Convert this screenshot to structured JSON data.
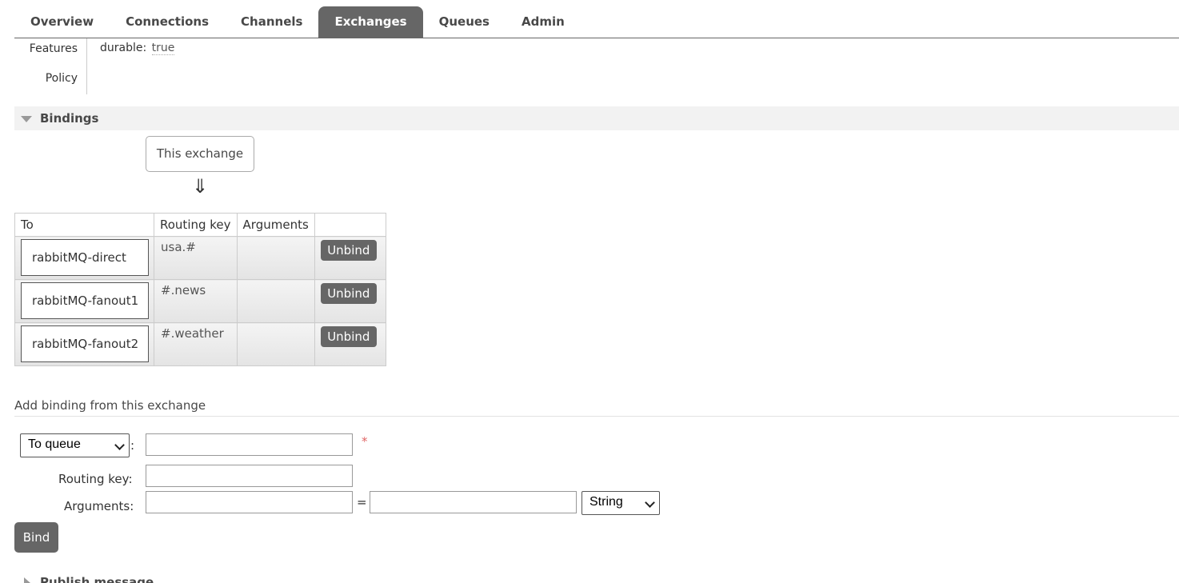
{
  "nav": {
    "tabs": [
      {
        "label": "Overview"
      },
      {
        "label": "Connections"
      },
      {
        "label": "Channels"
      },
      {
        "label": "Exchanges",
        "active": true
      },
      {
        "label": "Queues"
      },
      {
        "label": "Admin"
      }
    ]
  },
  "details": {
    "features_label": "Features",
    "policy_label": "Policy",
    "durable_key": "durable:",
    "durable_value": "true"
  },
  "bindings": {
    "title": "Bindings",
    "this_exchange": "This exchange",
    "arrow": "⇓",
    "columns": [
      "To",
      "Routing key",
      "Arguments",
      ""
    ],
    "rows": [
      {
        "to": "rabbitMQ-direct",
        "routing_key": "usa.#",
        "arguments": "",
        "action": "Unbind"
      },
      {
        "to": "rabbitMQ-fanout1",
        "routing_key": "#.news",
        "arguments": "",
        "action": "Unbind"
      },
      {
        "to": "rabbitMQ-fanout2",
        "routing_key": "#.weather",
        "arguments": "",
        "action": "Unbind"
      }
    ]
  },
  "add_binding": {
    "title": "Add binding from this exchange",
    "dest_type": "To queue",
    "dest_colon": ":",
    "dest_value": "",
    "required_mark": "*",
    "routing_key_label": "Routing key:",
    "routing_key_value": "",
    "arguments_label": "Arguments:",
    "arg_key_value": "",
    "equals": "=",
    "arg_value_value": "",
    "arg_type": "String",
    "bind_label": "Bind"
  },
  "publish": {
    "title": "Publish message"
  },
  "colors": {
    "active_tab_bg": "#666666",
    "button_bg": "#666666",
    "required": "#e06666",
    "section_bg": "#f2f2f2"
  }
}
